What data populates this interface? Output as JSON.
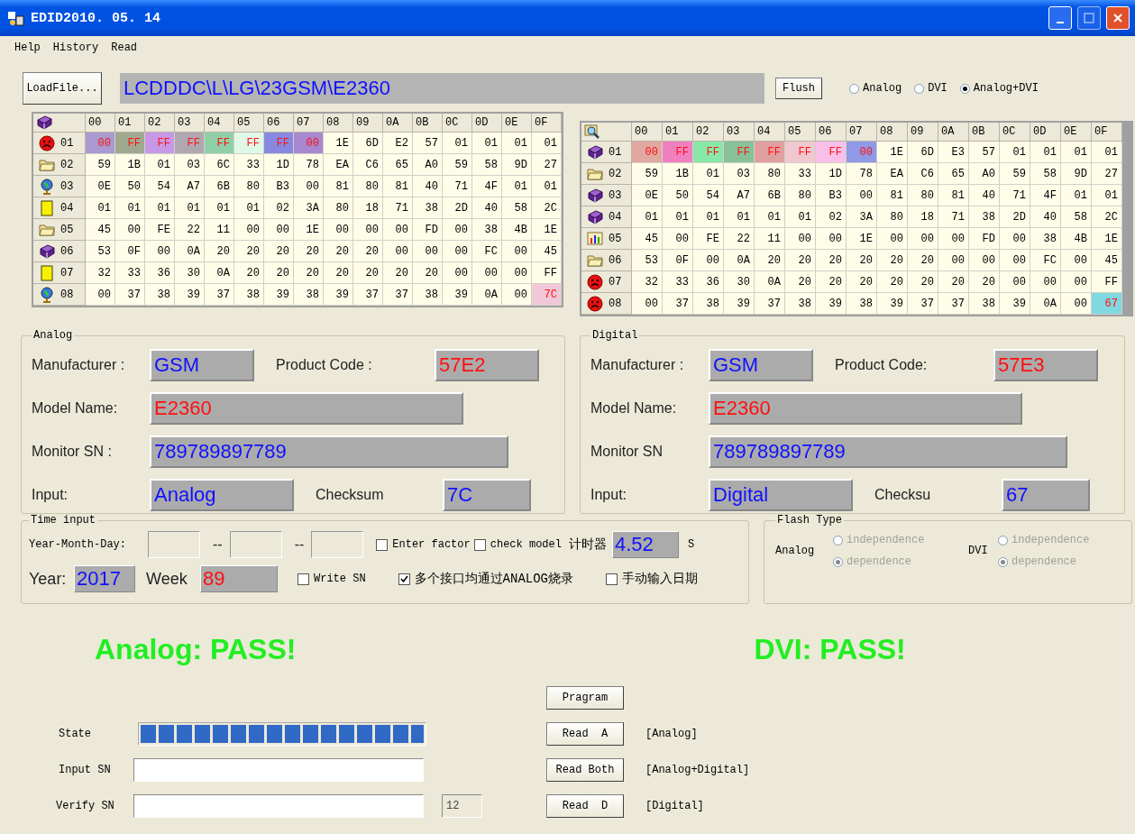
{
  "window": {
    "title": "EDID2010. 05. 14"
  },
  "menu": [
    {
      "label": "Help"
    },
    {
      "label": "History"
    },
    {
      "label": "Read"
    }
  ],
  "toolbar": {
    "load_button": "LoadFile...",
    "path": "LCDDDC\\L\\LG\\23GSM\\E2360",
    "flush_button": "Flush",
    "modes": [
      {
        "label": "Analog",
        "selected": false
      },
      {
        "label": "DVI",
        "selected": false
      },
      {
        "label": "Analog+DVI",
        "selected": true
      }
    ]
  },
  "tables": [
    {
      "columns": [
        "00",
        "01",
        "02",
        "03",
        "04",
        "05",
        "06",
        "07",
        "08",
        "09",
        "0A",
        "0B",
        "0C",
        "0D",
        "0E",
        "0F"
      ],
      "rows": [
        {
          "label": "01",
          "cells": [
            {
              "value": "00",
              "color": "#a99ad0"
            },
            {
              "value": "FF",
              "color": "#a0a890"
            },
            {
              "value": "FF",
              "color": "#c898e8"
            },
            {
              "value": "FF",
              "color": "#b0a8b0"
            },
            {
              "value": "FF",
              "color": "#90d0a8"
            },
            {
              "value": "FF",
              "color": "#e0f8e8"
            },
            {
              "value": "FF",
              "color": "#8888e0"
            },
            {
              "value": "00",
              "color": "#a888d0"
            },
            "1E",
            "6D",
            "E2",
            "57",
            "01",
            "01",
            "01",
            "01"
          ]
        },
        {
          "label": "02",
          "cells": [
            "59",
            "1B",
            "01",
            "03",
            "6C",
            "33",
            "1D",
            "78",
            "EA",
            "C6",
            "65",
            "A0",
            "59",
            "58",
            "9D",
            "27"
          ]
        },
        {
          "label": "03",
          "cells": [
            "0E",
            "50",
            "54",
            "A7",
            "6B",
            "80",
            "B3",
            "00",
            "81",
            "80",
            "81",
            "40",
            "71",
            "4F",
            "01",
            "01"
          ]
        },
        {
          "label": "04",
          "cells": [
            "01",
            "01",
            "01",
            "01",
            "01",
            "01",
            "02",
            "3A",
            "80",
            "18",
            "71",
            "38",
            "2D",
            "40",
            "58",
            "2C"
          ]
        },
        {
          "label": "05",
          "cells": [
            "45",
            "00",
            "FE",
            "22",
            "11",
            "00",
            "00",
            "1E",
            "00",
            "00",
            "00",
            "FD",
            "00",
            "38",
            "4B",
            "1E"
          ]
        },
        {
          "label": "06",
          "cells": [
            "53",
            "0F",
            "00",
            "0A",
            "20",
            "20",
            "20",
            "20",
            "20",
            "20",
            "00",
            "00",
            "00",
            "FC",
            "00",
            "45"
          ]
        },
        {
          "label": "07",
          "cells": [
            "32",
            "33",
            "36",
            "30",
            "0A",
            "20",
            "20",
            "20",
            "20",
            "20",
            "20",
            "20",
            "00",
            "00",
            "00",
            "FF"
          ]
        },
        {
          "label": "08",
          "cells": [
            "00",
            "37",
            "38",
            "39",
            "37",
            "38",
            "39",
            "38",
            "39",
            "37",
            "37",
            "38",
            "39",
            "0A",
            "00",
            {
              "value": "7C",
              "color": "#f0c8d8"
            }
          ]
        }
      ]
    },
    {
      "columns": [
        "00",
        "01",
        "02",
        "03",
        "04",
        "05",
        "06",
        "07",
        "08",
        "09",
        "0A",
        "0B",
        "0C",
        "0D",
        "0E",
        "0F"
      ],
      "rows": [
        {
          "label": "01",
          "cells": [
            {
              "value": "00",
              "color": "#e0a8a0"
            },
            {
              "value": "FF",
              "color": "#f080c0"
            },
            {
              "value": "FF",
              "color": "#88e8a8"
            },
            {
              "value": "FF",
              "color": "#88c098"
            },
            {
              "value": "FF",
              "color": "#e0a0a0"
            },
            {
              "value": "FF",
              "color": "#f0c8d0"
            },
            {
              "value": "FF",
              "color": "#f8c0e8"
            },
            {
              "value": "00",
              "color": "#9098e8"
            },
            "1E",
            "6D",
            "E3",
            "57",
            "01",
            "01",
            "01",
            "01"
          ]
        },
        {
          "label": "02",
          "cells": [
            "59",
            "1B",
            "01",
            "03",
            "80",
            "33",
            "1D",
            "78",
            "EA",
            "C6",
            "65",
            "A0",
            "59",
            "58",
            "9D",
            "27"
          ]
        },
        {
          "label": "03",
          "cells": [
            "0E",
            "50",
            "54",
            "A7",
            "6B",
            "80",
            "B3",
            "00",
            "81",
            "80",
            "81",
            "40",
            "71",
            "4F",
            "01",
            "01"
          ]
        },
        {
          "label": "04",
          "cells": [
            "01",
            "01",
            "01",
            "01",
            "01",
            "01",
            "02",
            "3A",
            "80",
            "18",
            "71",
            "38",
            "2D",
            "40",
            "58",
            "2C"
          ]
        },
        {
          "label": "05",
          "cells": [
            "45",
            "00",
            "FE",
            "22",
            "11",
            "00",
            "00",
            "1E",
            "00",
            "00",
            "00",
            "FD",
            "00",
            "38",
            "4B",
            "1E"
          ]
        },
        {
          "label": "06",
          "cells": [
            "53",
            "0F",
            "00",
            "0A",
            "20",
            "20",
            "20",
            "20",
            "20",
            "20",
            "00",
            "00",
            "00",
            "FC",
            "00",
            "45"
          ]
        },
        {
          "label": "07",
          "cells": [
            "32",
            "33",
            "36",
            "30",
            "0A",
            "20",
            "20",
            "20",
            "20",
            "20",
            "20",
            "20",
            "00",
            "00",
            "00",
            "FF"
          ]
        },
        {
          "label": "08",
          "cells": [
            "00",
            "37",
            "38",
            "39",
            "37",
            "38",
            "39",
            "38",
            "39",
            "37",
            "37",
            "38",
            "39",
            "0A",
            "00",
            {
              "value": "67",
              "color": "#80d8e0"
            }
          ]
        }
      ]
    }
  ],
  "panels": [
    {
      "title": "Analog",
      "rows": [
        {
          "fields": [
            {
              "label": "Manufacturer :",
              "value": "GSM",
              "color": "#1010ff"
            },
            {
              "label": "Product Code :",
              "value": "57E2",
              "color": "#ff1010"
            }
          ]
        },
        {
          "fields": [
            {
              "label": "Model Name:",
              "value": "E2360",
              "color": "#ff1010"
            }
          ]
        },
        {
          "fields": [
            {
              "label": "Monitor SN :",
              "value": "789789897789",
              "color": "#1010ff"
            }
          ]
        },
        {
          "fields": [
            {
              "label": "Input:",
              "value": "Analog",
              "color": "#1010ff"
            },
            {
              "label": "Checksum",
              "value": "7C",
              "color": "#1010ff"
            }
          ]
        }
      ]
    },
    {
      "title": "Digital",
      "rows": [
        {
          "fields": [
            {
              "label": "Manufacturer :",
              "value": "GSM",
              "color": "#1010ff"
            },
            {
              "label": "Product Code:",
              "value": "57E3",
              "color": "#ff1010"
            }
          ]
        },
        {
          "fields": [
            {
              "label": "Model Name:",
              "value": "E2360",
              "color": "#ff1010"
            }
          ]
        },
        {
          "fields": [
            {
              "label": "Monitor SN",
              "value": "789789897789",
              "color": "#1010ff"
            }
          ]
        },
        {
          "fields": [
            {
              "label": "Input:",
              "value": "Digital",
              "color": "#1010ff"
            },
            {
              "label": "Checksu",
              "value": "67",
              "color": "#1010ff"
            }
          ]
        }
      ]
    }
  ],
  "time_input": {
    "title": "Time input",
    "date_label": "Year-Month-Day:",
    "separators": [
      "--",
      "--"
    ],
    "checks": [
      {
        "label": "Enter factor",
        "checked": false
      },
      {
        "label": "check model",
        "checked": false
      },
      {
        "label": "Write SN",
        "checked": false
      },
      {
        "label": "多个接口均通过ANALOG烧录",
        "checked": true
      },
      {
        "label": "手动输入日期",
        "checked": false
      }
    ],
    "timer_label": "计时器",
    "timer_value": "4.52",
    "timer_unit": "S",
    "year_label": "Year:",
    "year": "2017",
    "week_label": "Week",
    "week": "89"
  },
  "flash_type": {
    "title": "Flash Type",
    "disabled": true,
    "groups": [
      {
        "label": "Analog",
        "options": [
          {
            "label": "independence",
            "selected": false
          },
          {
            "label": "dependence",
            "selected": true
          }
        ]
      },
      {
        "label": "DVI",
        "options": [
          {
            "label": "independence",
            "selected": false
          },
          {
            "label": "dependence",
            "selected": true
          }
        ]
      }
    ]
  },
  "results": [
    {
      "text": "Analog: PASS!",
      "passed": true
    },
    {
      "text": "DVI: PASS!",
      "passed": true
    }
  ],
  "bottom": {
    "state_label": "State",
    "progress": {
      "level": 1
    },
    "input_sn_label": "Input SN",
    "verify_sn_label": "Verify SN",
    "verify_count": "12",
    "buttons": [
      {
        "label": "Pragram"
      },
      {
        "label": "Read  A",
        "note": "[Analog]"
      },
      {
        "label": "Read Both",
        "note": "[Analog+Digital]"
      },
      {
        "label": "Read  D",
        "note": "[Digital]"
      }
    ]
  }
}
